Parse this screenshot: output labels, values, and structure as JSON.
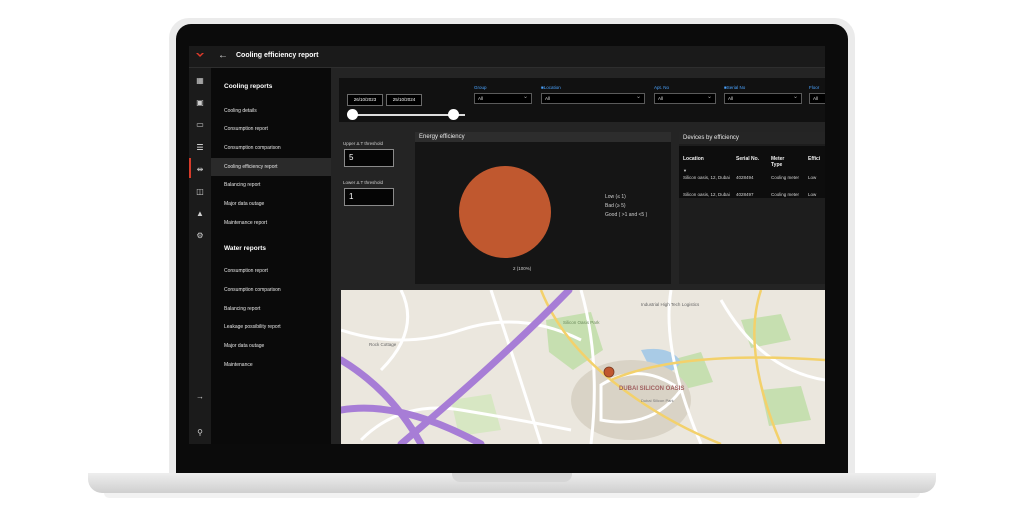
{
  "window": {
    "title": "Cooling efficiency report",
    "back_glyph": "←"
  },
  "rail_icons": [
    {
      "glyph": "▦",
      "name": "grid-icon"
    },
    {
      "glyph": "▣",
      "name": "devices-icon"
    },
    {
      "glyph": "▭",
      "name": "dashboard-icon"
    },
    {
      "glyph": "☰",
      "name": "reports-icon"
    },
    {
      "glyph": "⇹",
      "name": "transfer-icon"
    },
    {
      "glyph": "◫",
      "name": "layers-icon"
    },
    {
      "glyph": "▲",
      "name": "bell-icon"
    },
    {
      "glyph": "⚙",
      "name": "gear-icon"
    },
    {
      "glyph": "→",
      "name": "logout-icon"
    },
    {
      "glyph": "⚲",
      "name": "user-icon"
    }
  ],
  "sidebar": {
    "cooling_title": "Cooling reports",
    "cooling_items": [
      "Cooling details",
      "Consumption report",
      "Consumption comparison",
      "Cooling efficiency report",
      "Balancing report",
      "Major data outage",
      "Maintenance report"
    ],
    "water_title": "Water reports",
    "water_items": [
      "Consumption report",
      "Consumption comparison",
      "Balancing report",
      "Leakage possibility report",
      "Major data outage",
      "Maintenance"
    ]
  },
  "filters": {
    "date_from": "26/10/2023",
    "date_to": "25/10/2024",
    "group_label": "Group",
    "group_value": "All",
    "location_label": "Location",
    "location_value": "All",
    "apt_label": "Apt. No",
    "apt_value": "All",
    "serial_label": "Serial No",
    "serial_value": "All",
    "floor_label": "Floor",
    "floor_value": "All"
  },
  "thresholds": {
    "upper_label": "Upper Δ T threshold",
    "upper_value": "5",
    "lower_label": "Lower Δ T threshold",
    "lower_value": "1"
  },
  "energy": {
    "title": "Energy efficiency",
    "legend": [
      "Low (≤ 1)",
      "Bad (≥ 5)",
      "Good ( >1 and <5 )"
    ],
    "slice_label": "2 (100%)",
    "slice_color": "#c0582f"
  },
  "devices": {
    "title": "Devices by efficiency",
    "columns": [
      "Location",
      "Serial No.",
      "Meter Type",
      "Effici"
    ],
    "sort_glyph": "▼",
    "rows": [
      {
        "location": "Silicon oasis, 12, Dubai",
        "serial": "4028494",
        "meter": "Cooling meter",
        "eff": "Low"
      },
      {
        "location": "Silicon oasis, 12, Dubai",
        "serial": "4028497",
        "meter": "Cooling meter",
        "eff": "Low"
      }
    ]
  },
  "map": {
    "labels": [
      "Industrial High Tech Logistics",
      "Silicon Oasis Park",
      "DUBAI SILICON OASIS",
      "Rock Cottage",
      "Dubai Silicon Park"
    ],
    "marker_color": "#c0582f",
    "road_color": "#a77dd6"
  }
}
